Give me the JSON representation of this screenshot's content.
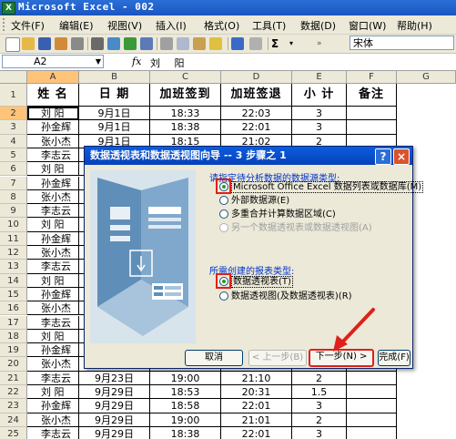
{
  "window": {
    "title": "Microsoft Excel - 002",
    "app_icon": "excel-icon"
  },
  "menu": [
    "文件(F)",
    "编辑(E)",
    "视图(V)",
    "插入(I)",
    "格式(O)",
    "工具(T)",
    "数据(D)",
    "窗口(W)",
    "帮助(H)"
  ],
  "toolbar": {
    "font_name": "宋体"
  },
  "formula_bar": {
    "cell_ref": "A2",
    "fx": "fx",
    "content": "刘 阳"
  },
  "columns": [
    "A",
    "B",
    "C",
    "D",
    "E",
    "F",
    "G"
  ],
  "rows": [
    "1",
    "2",
    "3",
    "4",
    "5",
    "6",
    "7",
    "8",
    "9",
    "10",
    "11",
    "12",
    "13",
    "14",
    "15",
    "16",
    "17",
    "18",
    "19",
    "20",
    "21",
    "22",
    "23",
    "24",
    "25"
  ],
  "table": {
    "headers": [
      "姓 名",
      "日 期",
      "加班签到",
      "加班签退",
      "小 计",
      "备注"
    ],
    "rows": [
      [
        "刘 阳",
        "9月1日",
        "18:33",
        "22:03",
        "3"
      ],
      [
        "孙金辉",
        "9月1日",
        "18:38",
        "22:01",
        "3"
      ],
      [
        "张小杰",
        "9月1日",
        "18:15",
        "21:02",
        "2"
      ],
      [
        "李志云",
        "",
        "",
        "",
        ""
      ],
      [
        "刘 阳",
        "",
        "",
        "",
        ""
      ],
      [
        "孙金辉",
        "",
        "",
        "",
        ""
      ],
      [
        "张小杰",
        "",
        "",
        "",
        ""
      ],
      [
        "李志云",
        "",
        "",
        "",
        ""
      ],
      [
        "刘 阳",
        "",
        "",
        "",
        ""
      ],
      [
        "孙金辉",
        "",
        "",
        "",
        ""
      ],
      [
        "张小杰",
        "",
        "",
        "",
        ""
      ],
      [
        "李志云",
        "",
        "",
        "",
        ""
      ],
      [
        "刘 阳",
        "",
        "",
        "",
        ""
      ],
      [
        "孙金辉",
        "",
        "",
        "",
        ""
      ],
      [
        "张小杰",
        "",
        "",
        "",
        ""
      ],
      [
        "李志云",
        "",
        "",
        "",
        ""
      ],
      [
        "刘 阳",
        "",
        "",
        "",
        ""
      ],
      [
        "孙金辉",
        "",
        "",
        "",
        ""
      ],
      [
        "张小杰",
        "",
        "",
        "",
        ""
      ],
      [
        "李志云",
        "9月23日",
        "19:00",
        "21:10",
        "2"
      ],
      [
        "刘 阳",
        "9月29日",
        "18:53",
        "20:31",
        "1.5"
      ],
      [
        "孙金辉",
        "9月29日",
        "18:58",
        "22:01",
        "3"
      ],
      [
        "张小杰",
        "9月29日",
        "19:00",
        "21:01",
        "2"
      ],
      [
        "李志云",
        "9月29日",
        "18:38",
        "22:01",
        "3"
      ]
    ]
  },
  "dialog": {
    "title": "数据透视表和数据透视图向导 -- 3 步骤之 1",
    "help": "?",
    "close": "×",
    "source_label": "请指定待分析数据的数据源类型:",
    "source_options": [
      {
        "label": "Microsoft Office Excel 数据列表或数据库(M)",
        "checked": true,
        "disabled": false
      },
      {
        "label": "外部数据源(E)",
        "checked": false,
        "disabled": false
      },
      {
        "label": "多重合并计算数据区域(C)",
        "checked": false,
        "disabled": false
      },
      {
        "label": "另一个数据透视表或数据透视图(A)",
        "checked": false,
        "disabled": true
      }
    ],
    "report_label": "所需创建的报表类型:",
    "report_options": [
      {
        "label": "数据透视表(T)",
        "checked": true
      },
      {
        "label": "数据透视图(及数据透视表)(R)",
        "checked": false
      }
    ],
    "buttons": {
      "cancel": "取消",
      "back": "< 上一步(B)",
      "next": "下一步(N) >",
      "finish": "完成(F)"
    }
  },
  "colors": {
    "title_bar": "#1a55c0",
    "highlight": "#e0201a",
    "selected_header": "#ffc47a",
    "dialog_bg": "#ece9d8"
  }
}
